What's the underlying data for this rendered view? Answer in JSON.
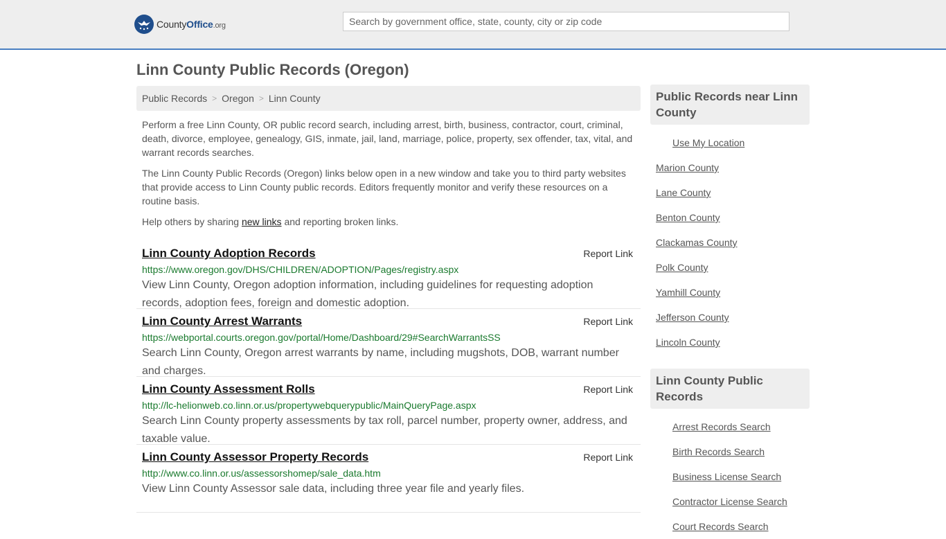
{
  "header": {
    "logo": {
      "county": "County",
      "office": "Office",
      "tld": ".org"
    },
    "search_placeholder": "Search by government office, state, county, city or zip code"
  },
  "page": {
    "title": "Linn County Public Records (Oregon)"
  },
  "breadcrumb": [
    "Public Records",
    "Oregon",
    "Linn County"
  ],
  "intro": {
    "p1": "Perform a free Linn County, OR public record search, including arrest, birth, business, contractor, court, criminal, death, divorce, employee, genealogy, GIS, inmate, jail, land, marriage, police, property, sex offender, tax, vital, and warrant records searches.",
    "p2": "The Linn County Public Records (Oregon) links below open in a new window and take you to third party websites that provide access to Linn County public records. Editors frequently monitor and verify these resources on a routine basis.",
    "p3_before": "Help others by sharing ",
    "p3_link": "new links",
    "p3_after": " and reporting broken links."
  },
  "report_label": "Report Link",
  "records": [
    {
      "title": "Linn County Adoption Records",
      "url": "https://www.oregon.gov/DHS/CHILDREN/ADOPTION/Pages/registry.aspx",
      "desc": "View Linn County, Oregon adoption information, including guidelines for requesting adoption records, adoption fees, foreign and domestic adoption."
    },
    {
      "title": "Linn County Arrest Warrants",
      "url": "https://webportal.courts.oregon.gov/portal/Home/Dashboard/29#SearchWarrantsSS",
      "desc": "Search Linn County, Oregon arrest warrants by name, including mugshots, DOB, warrant number and charges."
    },
    {
      "title": "Linn County Assessment Rolls",
      "url": "http://lc-helionweb.co.linn.or.us/propertywebquerypublic/MainQueryPage.aspx",
      "desc": "Search Linn County property assessments by tax roll, parcel number, property owner, address, and taxable value."
    },
    {
      "title": "Linn County Assessor Property Records",
      "url": "http://www.co.linn.or.us/assessorshomep/sale_data.htm",
      "desc": "View Linn County Assessor sale data, including three year file and yearly files."
    }
  ],
  "sidebar": {
    "nearby_title": "Public Records near Linn County",
    "use_location": "Use My Location",
    "nearby": [
      "Marion County",
      "Lane County",
      "Benton County",
      "Clackamas County",
      "Polk County",
      "Yamhill County",
      "Jefferson County",
      "Lincoln County"
    ],
    "records_title": "Linn County Public Records",
    "records": [
      "Arrest Records Search",
      "Birth Records Search",
      "Business License Search",
      "Contractor License Search",
      "Court Records Search"
    ]
  },
  "colors": {
    "accent": "#4a7fc1",
    "link_green": "#1a7a2e",
    "logo_blue": "#1f4e8c"
  }
}
